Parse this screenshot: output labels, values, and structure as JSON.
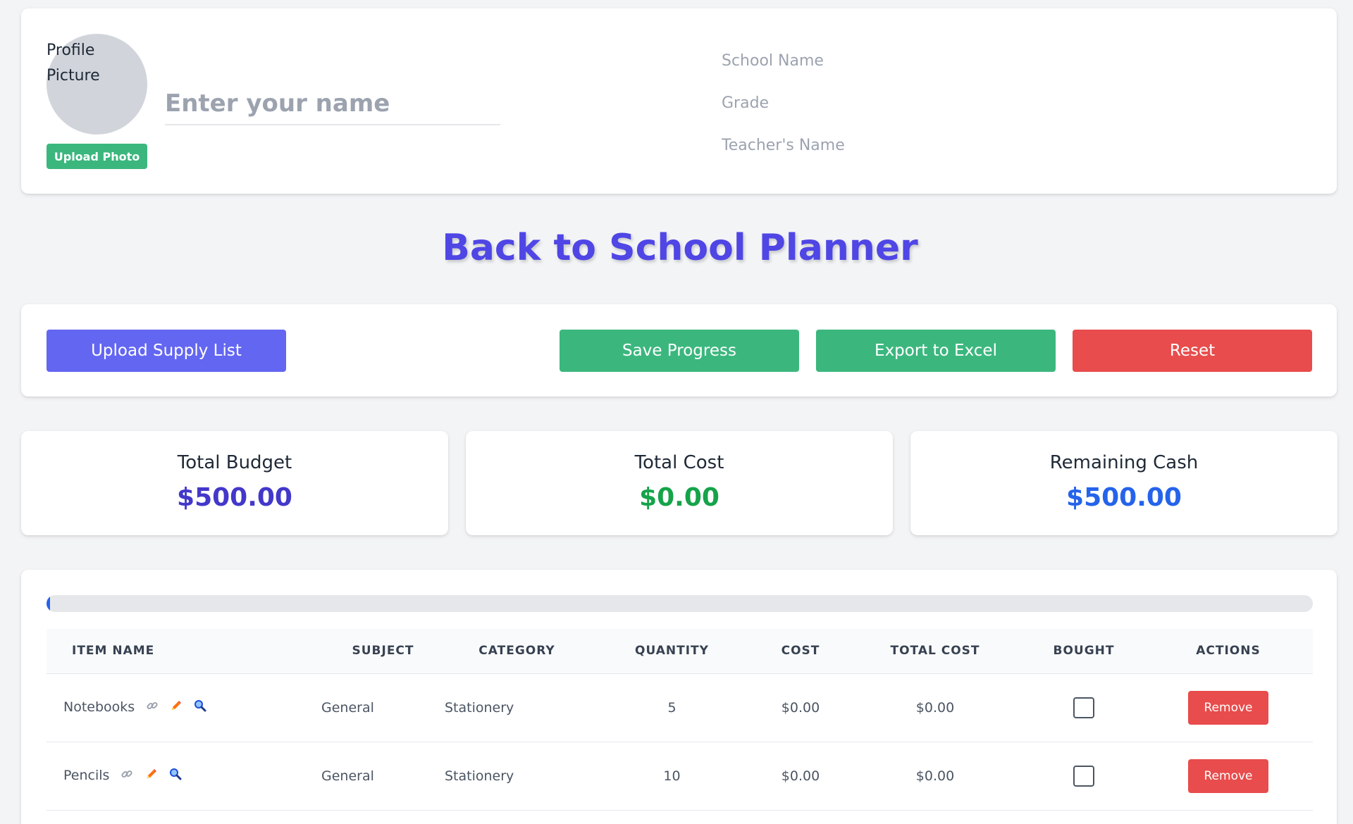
{
  "profile": {
    "avatar_alt": "Profile Picture",
    "upload_photo_label": "Upload Photo",
    "name_placeholder": "Enter your name",
    "school_name_placeholder": "School Name",
    "grade_placeholder": "Grade",
    "teacher_placeholder": "Teacher's Name"
  },
  "title": "Back to School Planner",
  "actions": {
    "upload_label": "Upload Supply List",
    "save_label": "Save Progress",
    "export_label": "Export to Excel",
    "reset_label": "Reset"
  },
  "stats": {
    "budget_label": "Total Budget",
    "budget_value": "$500.00",
    "cost_label": "Total Cost",
    "cost_value": "$0.00",
    "remaining_label": "Remaining Cash",
    "remaining_value": "$500.00"
  },
  "progress": {
    "percent": 0
  },
  "table": {
    "headers": {
      "name": "Item Name",
      "subject": "Subject",
      "category": "Category",
      "quantity": "Quantity",
      "cost": "Cost",
      "total": "Total Cost",
      "bought": "Bought",
      "actions": "Actions"
    },
    "rows": [
      {
        "name": "Notebooks",
        "subject": "General",
        "category": "Stationery",
        "quantity": "5",
        "cost": "$0.00",
        "total": "$0.00",
        "bought": false,
        "remove_label": "Remove"
      },
      {
        "name": "Pencils",
        "subject": "General",
        "category": "Stationery",
        "quantity": "10",
        "cost": "$0.00",
        "total": "$0.00",
        "bought": false,
        "remove_label": "Remove"
      }
    ],
    "row_icons": [
      "link-icon",
      "pencil-icon",
      "magnifier-icon"
    ]
  },
  "colors": {
    "primary": "#6366f1",
    "title": "#4f46e5",
    "success": "#3bb77e",
    "danger": "#e84c4c",
    "budget": "#4338ca",
    "cost": "#16a34a",
    "remaining": "#2563eb"
  }
}
